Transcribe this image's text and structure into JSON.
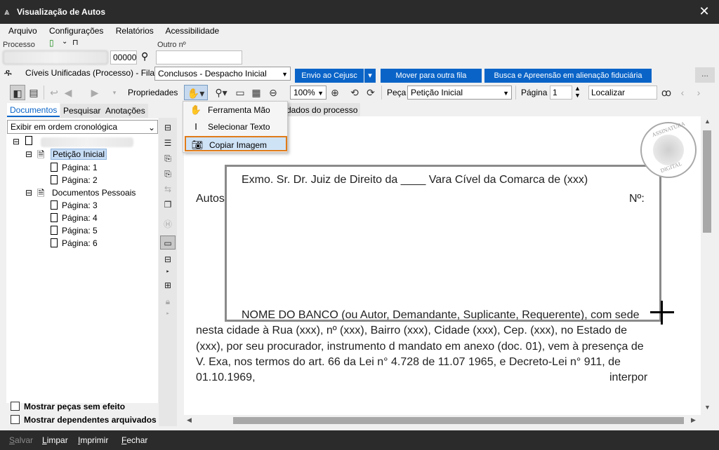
{
  "window": {
    "title": "Visualização de Autos",
    "close": "✕"
  },
  "menu": [
    "Arquivo",
    "Configurações",
    "Relatórios",
    "Acessibilidade"
  ],
  "process": {
    "label": "Processo",
    "number_suffix": "00000",
    "other_label": "Outro nº",
    "other_value": ""
  },
  "queue": {
    "prefix": "Cíveis Unificadas (Processo) - Fila:",
    "selected": "Conclusos - Despacho Inicial",
    "buttons": [
      "Envio ao Cejusc",
      "Mover para outra fila",
      "Busca e Apreensão em alienação fiduciária"
    ],
    "more": "..."
  },
  "toolbar": {
    "properties": "Propriedades",
    "zoom": "100%",
    "peca_label": "Peça",
    "peca_value": "Petição Inicial",
    "pagina_label": "Página",
    "pagina_value": "1",
    "localizar_placeholder": "Localizar"
  },
  "left_tabs": [
    "Documentos",
    "Pesquisar",
    "Anotações"
  ],
  "order_select": "Exibir em ordem cronológica",
  "tree": {
    "group1": "Petição Inicial",
    "group1_pages": [
      "Página: 1",
      "Página: 2"
    ],
    "group2": "Documentos Pessoais",
    "group2_pages": [
      "Página: 3",
      "Página: 4",
      "Página: 5",
      "Página: 6"
    ]
  },
  "checkboxes": [
    "Mostrar peças sem efeito",
    "Mostrar dependentes arquivados"
  ],
  "doc_tab": "dados do processo",
  "popup_menu": [
    "Ferramenta Mão",
    "Selecionar Texto",
    "Copiar Imagem"
  ],
  "stamp": {
    "top": "ASSINATURA",
    "bottom": "DIGITAL"
  },
  "document": {
    "heading": "Exmo. Sr. Dr. Juiz de Direito da ____ Vara Cível da Comarca de (xxx)",
    "autos": "Autos",
    "numero": "Nº:",
    "para1": "NOME DO BANCO (ou Autor, Demandante, Suplicante, Requerente), com sede",
    "para2": "nesta cidade à Rua (xxx), nº (xxx), Bairro (xxx), Cidade (xxx), Cep. (xxx), no Estado de",
    "para3": "(xxx), por seu procurador, instrumento d mandato em anexo (doc. 01), vem à presença de",
    "para4": "V. Exa, nos termos do art. 66 da Lei n° 4.728 de 11.07 1965, e Decreto-Lei n° 911, de",
    "para5a": "01.10.1969,",
    "para5b": "interpor"
  },
  "footer": [
    "Salvar",
    "Limpar",
    "Imprimir",
    "Fechar"
  ]
}
